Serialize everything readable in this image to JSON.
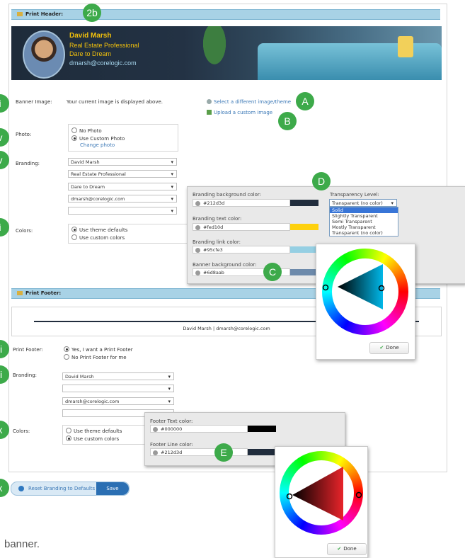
{
  "print_header": {
    "title": "Print Header:"
  },
  "banner": {
    "name": "David Marsh",
    "title": "Real Estate Professional",
    "tagline": "Dare to Dream",
    "email": "dmarsh@corelogic.com"
  },
  "banner_image": {
    "label": "Banner Image:",
    "text": "Your current image is displayed above.",
    "select_link": "Select a different image/theme",
    "upload_link": "Upload a custom image"
  },
  "photo": {
    "label": "Photo:",
    "options": [
      "No Photo",
      "Use Custom Photo"
    ],
    "selected": 1,
    "change_link": "Change photo"
  },
  "branding": {
    "label": "Branding:",
    "selects": [
      "David Marsh",
      "Real Estate Professional",
      "Dare to Dream",
      "dmarsh@corelogic.com",
      ""
    ]
  },
  "colors": {
    "label": "Colors:",
    "options": [
      "Use theme defaults",
      "Use custom colors"
    ],
    "selected": 0
  },
  "header_colors": {
    "fields": [
      {
        "label": "Branding background color:",
        "value": "#212d3d",
        "swatch": "#212d3d"
      },
      {
        "label": "Branding text color:",
        "value": "#fed10d",
        "swatch": "#fed10d"
      },
      {
        "label": "Branding link color:",
        "value": "#95cfe3",
        "swatch": "#95cfe3"
      },
      {
        "label": "Banner background color:",
        "value": "#6d8aab",
        "swatch": "#6d8aab"
      }
    ],
    "transparency": {
      "label": "Transparency Level:",
      "value": "Transparent (no color)",
      "options": [
        "Solid",
        "Slightly Transparent",
        "Semi Transparent",
        "Mostly Transparent",
        "Transparent (no color)"
      ],
      "highlighted": 0
    }
  },
  "print_footer": {
    "title": "Print Footer:",
    "preview_text": "David Marsh | dmarsh@corelogic.com",
    "label": "Print Footer:",
    "options": [
      "Yes, I want a Print Footer",
      "No Print Footer for me"
    ],
    "selected": 0
  },
  "footer_branding": {
    "label": "Branding:",
    "selects": [
      "David Marsh",
      "",
      "dmarsh@corelogic.com",
      ""
    ]
  },
  "footer_colors": {
    "label": "Colors:",
    "options": [
      "Use theme defaults",
      "Use custom colors"
    ],
    "selected": 1,
    "fields": [
      {
        "label": "Footer Text color:",
        "value": "#000000",
        "swatch": "#000000"
      },
      {
        "label": "Footer Line color:",
        "value": "#212d3d",
        "swatch": "#212d3d"
      }
    ]
  },
  "buttons": {
    "reset": "Reset Branding to Defaults",
    "save": "Save",
    "done": "Done"
  },
  "callouts": {
    "a": "A",
    "b": "B",
    "c": "C",
    "d": "D",
    "e": "E",
    "top": "2b",
    "side": [
      "i",
      "v",
      "v",
      "i",
      "ii",
      "ii",
      "x",
      "x"
    ]
  },
  "caption": "banner."
}
